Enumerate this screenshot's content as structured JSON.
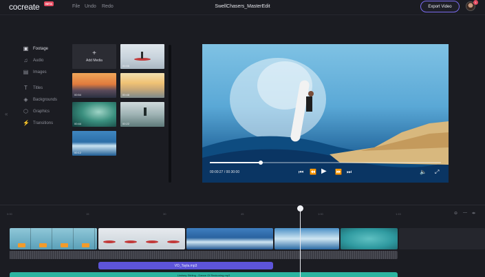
{
  "app": {
    "logo": "cocreate",
    "logo_badge": "BETA",
    "project_title": "SwellChasers_MasterEdit",
    "export_label": "Export Video",
    "notification_count": "1"
  },
  "menu": [
    {
      "label": "File"
    },
    {
      "label": "Undo"
    },
    {
      "label": "Redo"
    }
  ],
  "sidebar": {
    "items": [
      {
        "label": "Footage",
        "icon": "film-icon",
        "glyph": "▣"
      },
      {
        "label": "Audio",
        "icon": "audio-icon",
        "glyph": "♫"
      },
      {
        "label": "Images",
        "icon": "image-icon",
        "glyph": "▤"
      },
      {
        "label": "Titles",
        "icon": "text-icon",
        "glyph": "T"
      },
      {
        "label": "Backgrounds",
        "icon": "layers-icon",
        "glyph": "◈"
      },
      {
        "label": "Graphics",
        "icon": "graphics-icon",
        "glyph": "⬡"
      },
      {
        "label": "Transitions",
        "icon": "transition-icon",
        "glyph": "⚡"
      }
    ],
    "collapse_glyph": "«"
  },
  "media": {
    "add_label": "Add Media",
    "add_glyph": "+",
    "clips": [
      {
        "duration": "00:56"
      },
      {
        "duration": "00:54"
      },
      {
        "duration": "00:48"
      },
      {
        "duration": "00:44"
      },
      {
        "duration": "00:22"
      },
      {
        "duration": "00:12"
      }
    ]
  },
  "preview": {
    "timecode": "00:00:27 / 00:30:00",
    "progress": 0.22
  },
  "timeline": {
    "ticks": [
      "0:00",
      "15",
      "30",
      "45",
      "1:00",
      "1:15"
    ],
    "vo_label": "VO_Tayla.mp3",
    "music_label": "Lindsey Stirling - Dance Of Reckoning.mp3"
  },
  "colors": {
    "accent": "#7b6cf0",
    "voice_track": "#5d54d9",
    "music_track": "#2db4a0",
    "badge": "#e64b61"
  }
}
